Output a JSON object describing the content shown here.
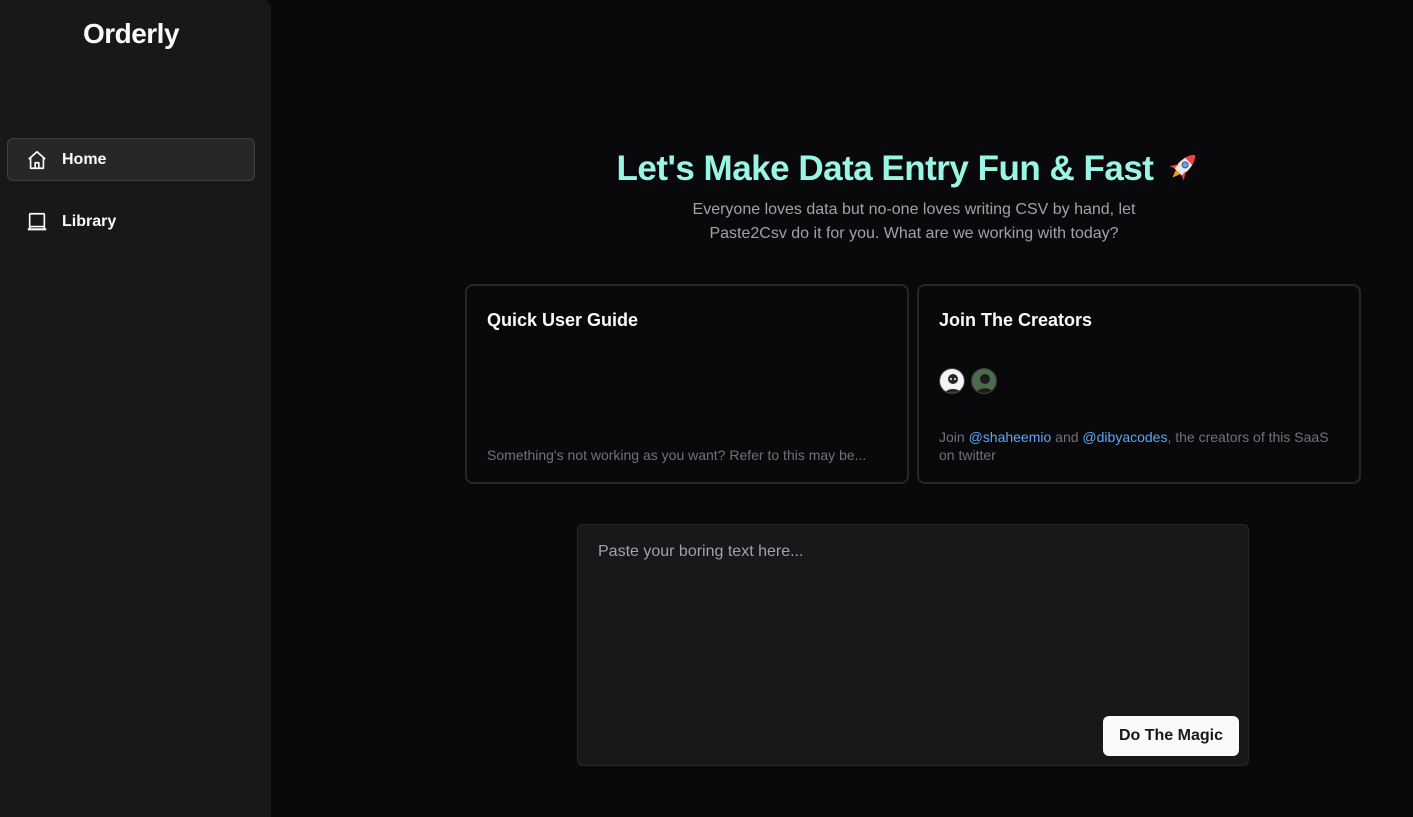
{
  "sidebar": {
    "brand": "Orderly",
    "items": [
      {
        "label": "Home",
        "icon": "home-icon",
        "active": true
      },
      {
        "label": "Library",
        "icon": "laptop-icon",
        "active": false
      }
    ]
  },
  "hero": {
    "title": "Let's Make Data Entry Fun & Fast",
    "title_icon": "rocket-icon",
    "subtitle": "Everyone loves data but no-one loves writing CSV by hand, let Paste2Csv do it for you. What are we working with today?"
  },
  "cards": {
    "guide": {
      "title": "Quick User Guide",
      "description": "Something's not working as you want? Refer to this may be..."
    },
    "creators": {
      "title": "Join The Creators",
      "desc_prefix": "Join ",
      "creator1": "@shaheemio",
      "desc_and": " and ",
      "creator2": "@dibyacodes",
      "desc_suffix": ", the creators of this SaaS on twitter"
    }
  },
  "input": {
    "placeholder": "Paste your boring text here...",
    "value": ""
  },
  "actions": {
    "submit_label": "Do The Magic"
  },
  "colors": {
    "accent": "#99f6e4",
    "link": "#60a5fa",
    "background": "#09090b",
    "sidebar": "#18181b"
  }
}
